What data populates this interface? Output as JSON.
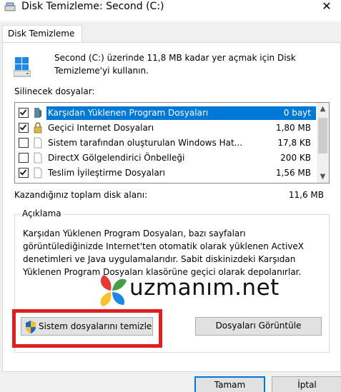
{
  "window": {
    "title": "Disk Temizleme:  Second (C:)",
    "close_glyph": "✕"
  },
  "tabs": [
    {
      "label": "Disk Temizleme"
    }
  ],
  "intro": {
    "text": "Second (C:) üzerinde 11,8 MB kadar yer açmak için Disk Temizleme'yi kullanın."
  },
  "files": {
    "label": "Silinecek dosyalar:",
    "items": [
      {
        "name": "Karşıdan Yüklenen Program Dosyaları",
        "size": "0 bayt",
        "checked": true,
        "selected": true
      },
      {
        "name": "Geçici Internet Dosyaları",
        "size": "1,80 MB",
        "checked": true,
        "selected": false
      },
      {
        "name": "Sistem tarafından oluşturulan Windows Hat...",
        "size": "17,8 KB",
        "checked": false,
        "selected": false
      },
      {
        "name": "DirectX Gölgelendirici Önbelleği",
        "size": "200 KB",
        "checked": false,
        "selected": false
      },
      {
        "name": "Teslim İyileştirme Dosyaları",
        "size": "1,56 MB",
        "checked": true,
        "selected": false
      }
    ]
  },
  "total": {
    "label": "Kazandığınız toplam disk alanı:",
    "value": "11,6 MB"
  },
  "description": {
    "title": "Açıklama",
    "text": "Karşıdan Yüklenen Program Dosyaları, bazı sayfaları görüntülediğinizde Internet'ten otomatik olarak yüklenen ActiveX denetimleri ve Java uygulamalarıdır. Sabit diskinizdeki Karşıdan Yüklenen Program Dosyaları klasörüne geçici olarak depolanırlar."
  },
  "watermark": {
    "text": "uzmanım.net"
  },
  "buttons": {
    "system_cleanup": "Sistem dosyalarını temizle",
    "view_files": "Dosyaları Görüntüle",
    "ok": "Tamam",
    "cancel": "İptal"
  },
  "colors": {
    "selection": "#0078d7",
    "highlight_frame": "#e02020"
  }
}
